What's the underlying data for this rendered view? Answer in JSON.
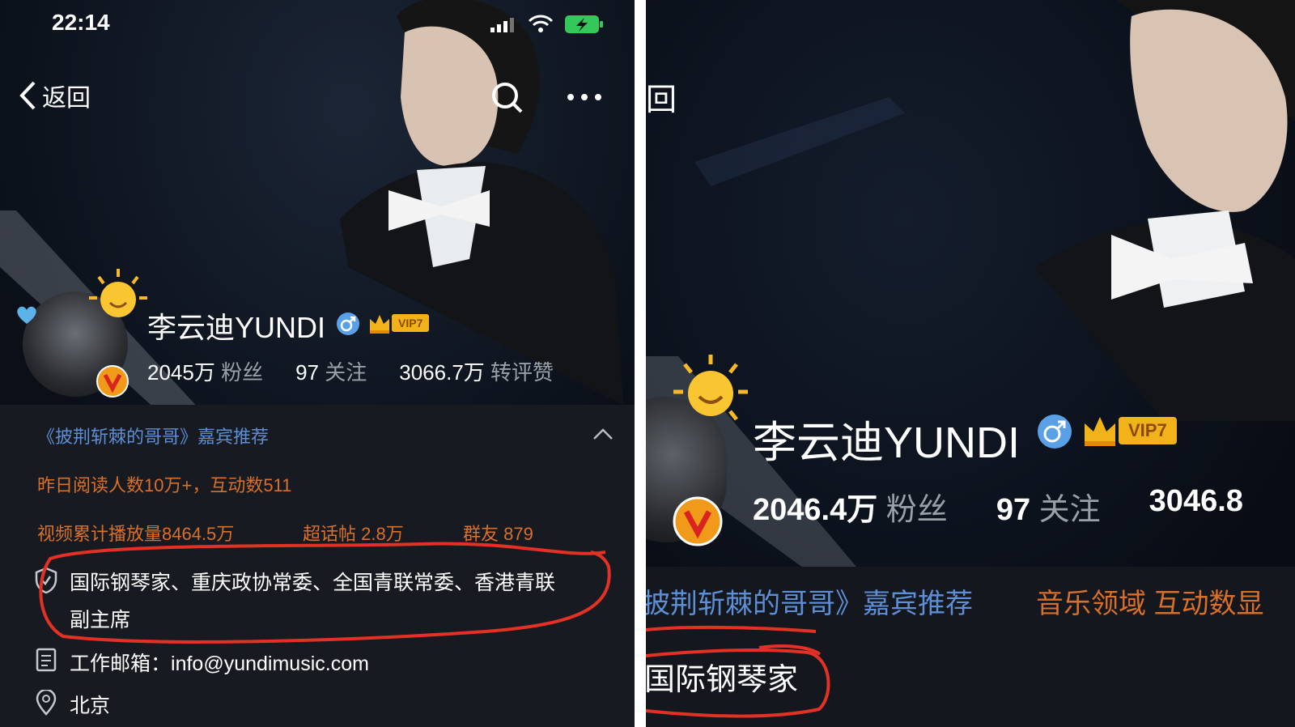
{
  "left": {
    "status_bar": {
      "time": "22:14"
    },
    "nav": {
      "back_label": "返回"
    },
    "profile": {
      "name": "李云迪YUNDI",
      "vip_label": "VIP7",
      "stats": [
        {
          "value": "2045万",
          "label": "粉丝"
        },
        {
          "value": "97",
          "label": "关注"
        },
        {
          "value": "3066.7万",
          "label": "转评赞"
        }
      ],
      "recommend": "《披荆斩棘的哥哥》嘉宾推荐",
      "reads": "昨日阅读人数10万+，互动数511",
      "video_plays": "视频累计播放量8464.5万",
      "super_topic": "超话帖 2.8万",
      "group_friends": "群友 879",
      "bio_line1": "国际钢琴家、重庆政协常委、全国青联常委、香港青联",
      "bio_line2": "副主席",
      "email_label": "工作邮箱：",
      "email": "info@yundimusic.com",
      "location": "北京"
    }
  },
  "right": {
    "nav_fragment": "回",
    "profile": {
      "name": "李云迪YUNDI",
      "vip_label": "VIP7",
      "stats": [
        {
          "value": "2046.4万",
          "label": "粉丝"
        },
        {
          "value": "97",
          "label": "关注"
        },
        {
          "value": "3046.8",
          "label": ""
        }
      ],
      "recommend": "披荆斩棘的哥哥》嘉宾推荐",
      "music_field": "音乐领域 互动数显",
      "bio": "国际钢琴家"
    }
  },
  "colors": {
    "background": "#0a0f18",
    "accent_orange": "#d9702a",
    "link_blue": "#5c8fd6",
    "annotation_red": "#e33125",
    "verified_blue": "#5aa0e6",
    "vip_gold": "#f1b21a"
  }
}
